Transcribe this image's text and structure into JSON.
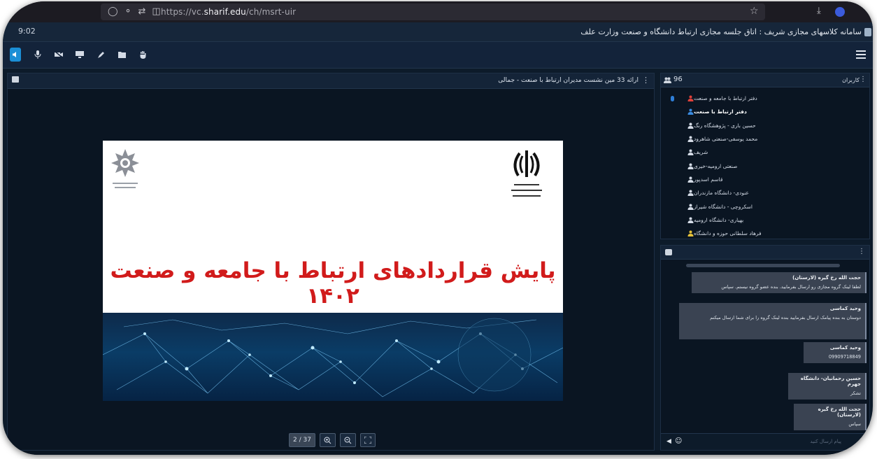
{
  "browser": {
    "url_prefix": "https://vc.",
    "url_domain": "sharif.edu",
    "url_path": "/ch/msrt-uir"
  },
  "header": {
    "clock": "9:02",
    "title": "سامانه کلاسهای مجازی شریف : اتاق جلسه مجازی ارتباط دانشگاه و صنعت وزارت علف"
  },
  "toolbar": {
    "buttons": [
      "speaker-icon",
      "microphone-icon",
      "camera-off-icon",
      "screen-share-icon",
      "whiteboard-pen-icon",
      "folder-icon",
      "raise-hand-icon"
    ]
  },
  "presentation": {
    "title": "ارائه 33 مین نشست مدیران ارتباط با صنعت - جمالی",
    "slide_headline": "پایش قراردادهای ارتباط با جامعه و صنعت ۱۴۰۲",
    "page_indicator": "2 / 37"
  },
  "users": {
    "title": "کاربران",
    "count": "96",
    "items": [
      {
        "name": "دفتر ارتباط با جامعه و صنعت",
        "color": "#e0413a",
        "bold": false
      },
      {
        "name": "دفتر ارتباط با صنعت",
        "color": "#3a8be0",
        "bold": true
      },
      {
        "name": "حسین باری - پژوهشگاه رنگ",
        "color": "#d4dbe6",
        "bold": false
      },
      {
        "name": "محمد یوسفی-صنعتی شاهرود",
        "color": "#d4dbe6",
        "bold": false
      },
      {
        "name": "شریف",
        "color": "#d4dbe6",
        "bold": false
      },
      {
        "name": "صنعتی ارومیه-خیری",
        "color": "#d4dbe6",
        "bold": false
      },
      {
        "name": "قاسم اسدپور",
        "color": "#d4dbe6",
        "bold": false
      },
      {
        "name": "عنودی- دانشگاه مازندران",
        "color": "#d4dbe6",
        "bold": false
      },
      {
        "name": "اسکروچی - دانشگاه شیراز",
        "color": "#d4dbe6",
        "bold": false
      },
      {
        "name": "بهیاری- دانشگاه ارومیه",
        "color": "#d4dbe6",
        "bold": false
      },
      {
        "name": "فرهاد سلطانی حوزه و دانشگاه",
        "color": "#e6c23a",
        "bold": false
      }
    ]
  },
  "chat": {
    "messages": [
      {
        "author": "حجت الله رخ گیره (لارستان)",
        "body": "لطفا لینک گروه مجازی رو ارسال بفرمایید. بنده عضو گروه نیستم. سپاس"
      },
      {
        "author": "وحید کماسی",
        "body": "دوستان به بنده پیامک ارسال بفرمایید بنده لینک گروه را برای شما ارسال میکنم"
      },
      {
        "author": "وحید کماسی",
        "body": "09909718849"
      },
      {
        "author": "حسین رحمانیان- دانشگاه جهرم",
        "body": "تشکر"
      },
      {
        "author": "حجت الله رخ گیره (لارستان)",
        "body": "سپاس"
      }
    ],
    "input_placeholder": "پیام ارسال کنید"
  }
}
